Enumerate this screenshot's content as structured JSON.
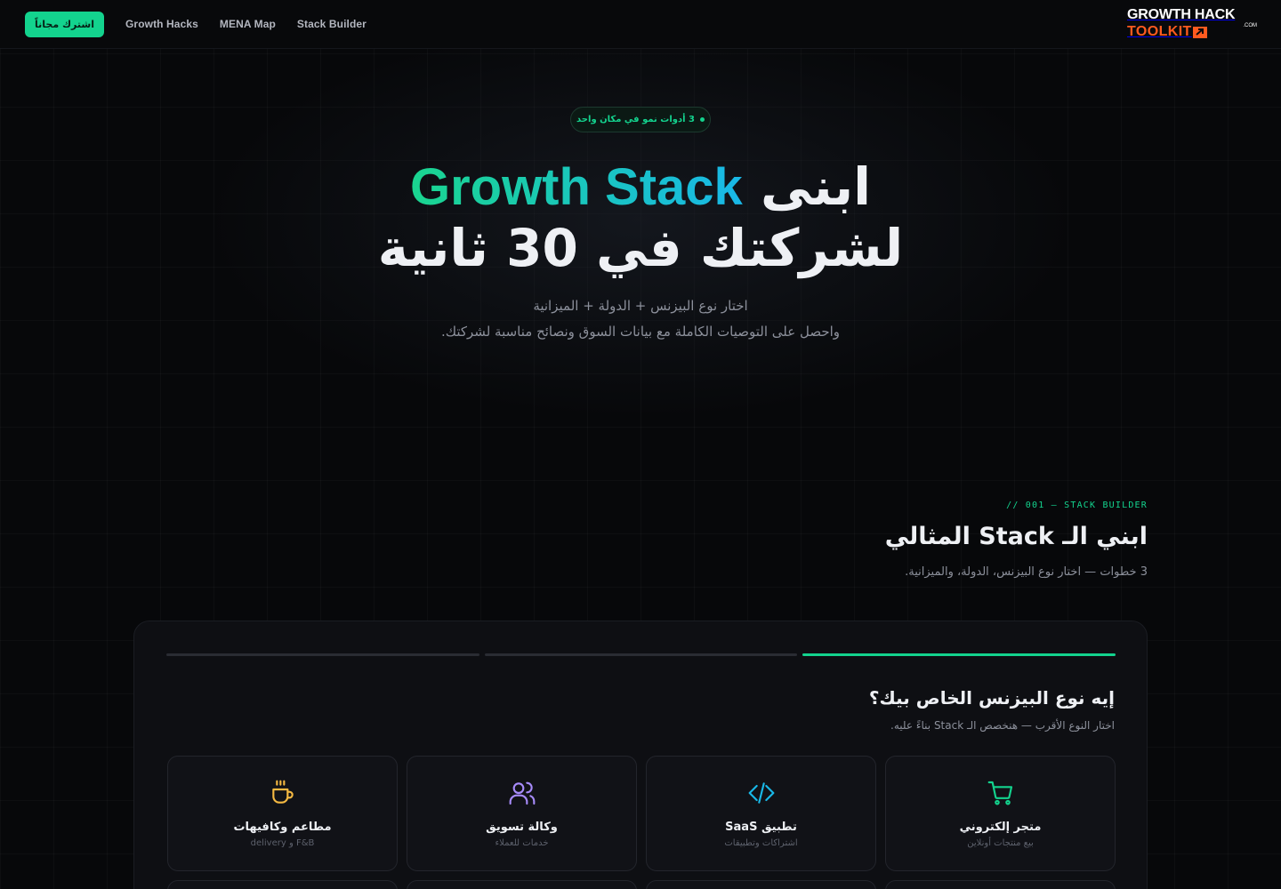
{
  "nav": {
    "cta_label": "اشترك مجاناً",
    "links": [
      "Growth Hacks",
      "MENA Map",
      "Stack Builder"
    ],
    "logo_top": "GROWTH HACK",
    "logo_bottom": "TOOLKIT",
    "logo_com": ".COM"
  },
  "hero": {
    "badge": "3 أدوات نمو في مكان واحد",
    "title_prefix": "ابنى",
    "title_highlight": "Growth Stack",
    "title_line2": "لشركتك في 30 ثانية",
    "sub_line1": "اختار نوع البيزنس + الدولة + الميزانية",
    "sub_line2": "واحصل على التوصيات الكاملة مع بيانات السوق ونصائح مناسبة لشركتك."
  },
  "section": {
    "kicker": "// 001 — STACK BUILDER",
    "title": "ابني الـ Stack المثالي",
    "subtitle": "3 خطوات — اختار نوع البيزنس، الدولة، والميزانية."
  },
  "wizard": {
    "steps": [
      {
        "active": true
      },
      {
        "active": false
      },
      {
        "active": false
      }
    ],
    "question": "إيه نوع البيزنس الخاص بيك؟",
    "question_sub": "اختار النوع الأقرب — هنخصص الـ Stack بناءً عليه.",
    "options": [
      {
        "title": "متجر إلكتروني",
        "desc": "بيع منتجات أونلاين",
        "icon": "cart-icon",
        "color": "#13d38e"
      },
      {
        "title": "تطبيق SaaS",
        "desc": "اشتراكات وتطبيقات",
        "icon": "code-icon",
        "color": "#19b8e8"
      },
      {
        "title": "وكالة تسويق",
        "desc": "خدمات للعملاء",
        "icon": "users-icon",
        "color": "#a78bfa"
      },
      {
        "title": "مطاعم وكافيهات",
        "desc": "F&B و delivery",
        "icon": "cup-icon",
        "color": "#f5b942"
      }
    ]
  }
}
